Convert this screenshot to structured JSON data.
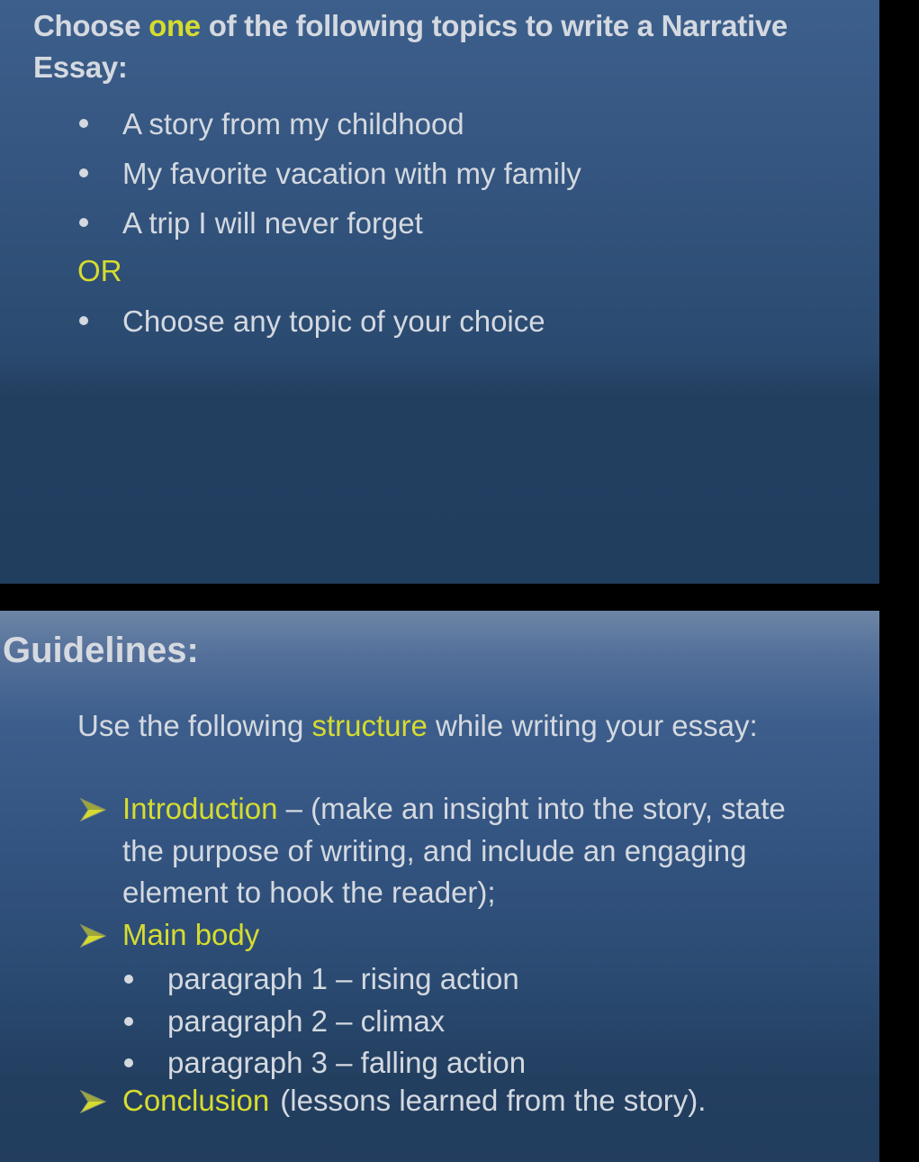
{
  "slide1": {
    "prompt": {
      "before": "Choose ",
      "highlight": "one",
      "after": " of the following topics to write a Narrative Essay:"
    },
    "topics": [
      "A story from my childhood",
      "My favorite vacation with my family",
      "A trip I will never forget"
    ],
    "or_label": "OR",
    "alternative": [
      "Choose any topic of your choice"
    ]
  },
  "slide2": {
    "title": "Guidelines:",
    "intro": {
      "before": "Use the following ",
      "highlight": "structure",
      "after": " while writing your essay:"
    },
    "structure": {
      "introduction": {
        "label": "Introduction",
        "text": " – (make an insight into the story, state the purpose of writing, and include an engaging element to hook the reader);"
      },
      "main_body": {
        "label": "Main body",
        "paragraphs": [
          "paragraph 1 – rising action",
          "paragraph 2 – climax",
          "paragraph 3 – falling action"
        ]
      },
      "conclusion": {
        "label": "Conclusion",
        "text": "(lessons learned from the story)."
      }
    }
  },
  "colors": {
    "accent": "#d6dc2f",
    "text": "#d4d9e0",
    "slide_background": "#2b4b73",
    "frame": "#000000"
  },
  "icons": {
    "topic_bullet": "bullet-dot-icon",
    "structure_bullet": "arrowhead-icon"
  }
}
